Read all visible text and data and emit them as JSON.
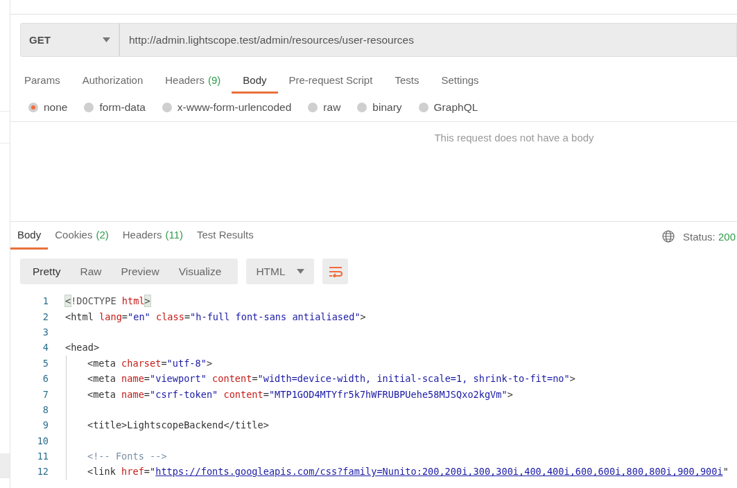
{
  "request": {
    "method": "GET",
    "url": "http://admin.lightscope.test/admin/resources/user-resources"
  },
  "request_tabs": [
    {
      "label": "Params",
      "selected": false
    },
    {
      "label": "Authorization",
      "selected": false
    },
    {
      "label": "Headers",
      "count": "(9)",
      "selected": false
    },
    {
      "label": "Body",
      "selected": true
    },
    {
      "label": "Pre-request Script",
      "selected": false
    },
    {
      "label": "Tests",
      "selected": false
    },
    {
      "label": "Settings",
      "selected": false
    }
  ],
  "body_types": [
    {
      "label": "none",
      "selected": true
    },
    {
      "label": "form-data",
      "selected": false
    },
    {
      "label": "x-www-form-urlencoded",
      "selected": false
    },
    {
      "label": "raw",
      "selected": false
    },
    {
      "label": "binary",
      "selected": false
    },
    {
      "label": "GraphQL",
      "selected": false
    }
  ],
  "empty_body_message": "This request does not have a body",
  "response_tabs": [
    {
      "label": "Body",
      "selected": true
    },
    {
      "label": "Cookies",
      "count": "(2)",
      "selected": false
    },
    {
      "label": "Headers",
      "count": "(11)",
      "selected": false
    },
    {
      "label": "Test Results",
      "selected": false
    }
  ],
  "status": {
    "label": "Status:",
    "value": "200"
  },
  "view_modes": [
    {
      "label": "Pretty",
      "selected": true
    },
    {
      "label": "Raw",
      "selected": false
    },
    {
      "label": "Preview",
      "selected": false
    },
    {
      "label": "Visualize",
      "selected": false
    }
  ],
  "format": "HTML",
  "code_lines": [
    {
      "number": "1",
      "tokens": [
        {
          "text": "<",
          "kind": "match"
        },
        {
          "text": "!DOCTYPE ",
          "kind": "meta"
        },
        {
          "text": "html",
          "kind": "attr"
        },
        {
          "text": ">",
          "kind": "match"
        }
      ]
    },
    {
      "number": "2",
      "tokens": [
        {
          "text": "<html ",
          "kind": "tag"
        },
        {
          "text": "lang",
          "kind": "attr"
        },
        {
          "text": "=",
          "kind": "tag"
        },
        {
          "text": "\"en\" ",
          "kind": "value"
        },
        {
          "text": "class",
          "kind": "attr"
        },
        {
          "text": "=",
          "kind": "tag"
        },
        {
          "text": "\"h-full font-sans antialiased\"",
          "kind": "value"
        },
        {
          "text": ">",
          "kind": "tag"
        }
      ]
    },
    {
      "number": "3"
    },
    {
      "number": "4",
      "tokens": [
        {
          "text": "<head>",
          "kind": "tag"
        }
      ],
      "children": [
        {
          "number": "5",
          "tokens": [
            {
              "text": "<meta ",
              "kind": "tag"
            },
            {
              "text": "charset",
              "kind": "attr"
            },
            {
              "text": "=",
              "kind": "tag"
            },
            {
              "text": "\"utf-8\"",
              "kind": "value"
            },
            {
              "text": ">",
              "kind": "tag"
            }
          ]
        },
        {
          "number": "6",
          "tokens": [
            {
              "text": "<meta ",
              "kind": "tag"
            },
            {
              "text": "name",
              "kind": "attr"
            },
            {
              "text": "=",
              "kind": "tag"
            },
            {
              "text": "\"viewport\" ",
              "kind": "value"
            },
            {
              "text": "content",
              "kind": "attr"
            },
            {
              "text": "=",
              "kind": "tag"
            },
            {
              "text": "\"width=device-width, initial-scale=1, shrink-to-fit=no\"",
              "kind": "value"
            },
            {
              "text": ">",
              "kind": "tag"
            }
          ]
        },
        {
          "number": "7",
          "tokens": [
            {
              "text": "<meta ",
              "kind": "tag"
            },
            {
              "text": "name",
              "kind": "attr"
            },
            {
              "text": "=",
              "kind": "tag"
            },
            {
              "text": "\"csrf-token\" ",
              "kind": "value"
            },
            {
              "text": "content",
              "kind": "attr"
            },
            {
              "text": "=",
              "kind": "tag"
            },
            {
              "text": "\"MTP1GOD4MTYfr5k7hWFRUBPUehe58MJSQxo2kgVm\"",
              "kind": "value"
            },
            {
              "text": ">",
              "kind": "tag"
            }
          ]
        },
        {
          "number": "8"
        },
        {
          "number": "9",
          "tokens": [
            {
              "text": "<title>LightscopeBackend</title>",
              "kind": "tag"
            }
          ]
        },
        {
          "number": "10"
        },
        {
          "number": "11",
          "tokens": [
            {
              "text": "<!-- Fonts -->",
              "kind": "comment"
            }
          ]
        },
        {
          "number": "12",
          "tokens": [
            {
              "text": "<link ",
              "kind": "tag"
            },
            {
              "text": "href",
              "kind": "attr"
            },
            {
              "text": "=\"",
              "kind": "tag"
            },
            {
              "text": "https://fonts.googleapis.com/css?family=Nunito:200,200i,300,300i,400,400i,600,600i,800,800i,900,900i",
              "kind": "link"
            },
            {
              "text": "\"",
              "kind": "tag"
            }
          ]
        }
      ]
    }
  ]
}
